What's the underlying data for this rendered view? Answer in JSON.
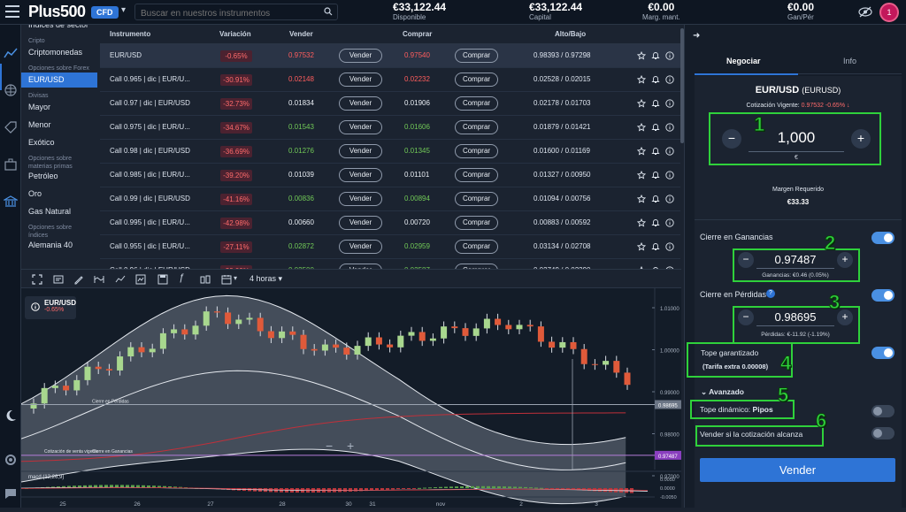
{
  "app": {
    "logo": "Plus500",
    "badge": "CFD"
  },
  "search": {
    "placeholder": "Buscar en nuestros instrumentos"
  },
  "account": [
    {
      "value": "€33,122.44",
      "label": "Disponible"
    },
    {
      "value": "€33,122.44",
      "label": "Capital"
    },
    {
      "value": "€0.00",
      "label": "Marg. mant."
    },
    {
      "value": "€0.00",
      "label": "Gan/Pér"
    }
  ],
  "notifications": {
    "count": "1"
  },
  "categories": [
    {
      "type": "item",
      "label": "Índices de sector"
    },
    {
      "type": "section",
      "label": "Cripto"
    },
    {
      "type": "item",
      "label": "Criptomonedas"
    },
    {
      "type": "section",
      "label": "Opciones sobre Forex"
    },
    {
      "type": "item",
      "label": "EUR/USD",
      "active": true
    },
    {
      "type": "section",
      "label": "Divisas"
    },
    {
      "type": "item",
      "label": "Mayor"
    },
    {
      "type": "item",
      "label": "Menor"
    },
    {
      "type": "item",
      "label": "Exótico"
    },
    {
      "type": "section",
      "label": "Opciones sobre materias primas"
    },
    {
      "type": "item",
      "label": "Petróleo"
    },
    {
      "type": "item",
      "label": "Oro"
    },
    {
      "type": "item",
      "label": "Gas Natural"
    },
    {
      "type": "section",
      "label": "Opciones sobre índices"
    },
    {
      "type": "item",
      "label": "Alemania 40"
    }
  ],
  "table": {
    "headers": {
      "instrument": "Instrumento",
      "change": "Variación",
      "sell": "Vender",
      "buy": "Comprar",
      "highlow": "Alto/Bajo"
    },
    "sell_button": "Vender",
    "buy_button": "Comprar",
    "rows": [
      {
        "name": "EUR/USD",
        "change": "-0.65%",
        "sell": "0.97532",
        "sell_dir": "dn",
        "buy": "0.97540",
        "buy_dir": "dn",
        "highlow": "0.98393 / 0.97298"
      },
      {
        "name": "Call 0.965 | dic | EUR/U...",
        "change": "-30.91%",
        "sell": "0.02148",
        "sell_dir": "dn",
        "buy": "0.02232",
        "buy_dir": "dn",
        "highlow": "0.02528 / 0.02015"
      },
      {
        "name": "Call 0.97 | dic | EUR/USD",
        "change": "-32.73%",
        "sell": "0.01834",
        "sell_dir": "",
        "buy": "0.01906",
        "buy_dir": "",
        "highlow": "0.02178 / 0.01703"
      },
      {
        "name": "Call 0.975 | dic | EUR/U...",
        "change": "-34.67%",
        "sell": "0.01543",
        "sell_dir": "up",
        "buy": "0.01606",
        "buy_dir": "up",
        "highlow": "0.01879 / 0.01421"
      },
      {
        "name": "Call 0.98 | dic | EUR/USD",
        "change": "-36.69%",
        "sell": "0.01276",
        "sell_dir": "up",
        "buy": "0.01345",
        "buy_dir": "up",
        "highlow": "0.01600 / 0.01169"
      },
      {
        "name": "Call 0.985 | dic | EUR/U...",
        "change": "-39.20%",
        "sell": "0.01039",
        "sell_dir": "",
        "buy": "0.01101",
        "buy_dir": "",
        "highlow": "0.01327 / 0.00950"
      },
      {
        "name": "Call 0.99 | dic | EUR/USD",
        "change": "-41.16%",
        "sell": "0.00836",
        "sell_dir": "up",
        "buy": "0.00894",
        "buy_dir": "up",
        "highlow": "0.01094 / 0.00756"
      },
      {
        "name": "Call 0.995 | dic | EUR/U...",
        "change": "-42.98%",
        "sell": "0.00660",
        "sell_dir": "",
        "buy": "0.00720",
        "buy_dir": "",
        "highlow": "0.00883 / 0.00592"
      },
      {
        "name": "Call 0.955 | dic | EUR/U...",
        "change": "-27.11%",
        "sell": "0.02872",
        "sell_dir": "up",
        "buy": "0.02959",
        "buy_dir": "up",
        "highlow": "0.03134 / 0.02708"
      },
      {
        "name": "Call 0.96 | dic | EUR/USD",
        "change": "-29.09%",
        "sell": "0.02500",
        "sell_dir": "up",
        "buy": "0.02587",
        "buy_dir": "up",
        "highlow": "0.02749 / 0.02390"
      }
    ]
  },
  "chart_toolbar": {
    "timeframe": "4 horas"
  },
  "chart": {
    "symbol": "EUR/USD",
    "change": "-0.65%",
    "price_ticks": [
      "1.01000",
      "1.00000",
      "0.99000",
      "0.98000",
      "0.97000"
    ],
    "current_price": "0.97487",
    "level_price": "0.98695",
    "x_ticks": [
      "25",
      "26",
      "27",
      "28",
      "30",
      "31",
      "nov",
      "2",
      "3"
    ],
    "stop_label": "Cierre en Pérdidas",
    "take_label": "Cierre en Ganancias",
    "sell_quote_label": "Cotización de venta vigente",
    "macd_label": "macd (12,26,9)",
    "macd_ticks": [
      "0.0050",
      "0.0000",
      "-0.0050"
    ]
  },
  "panel": {
    "tab_trade": "Negociar",
    "tab_info": "Info",
    "pair": "EUR/USD",
    "pair_sub": "(EURUSD)",
    "quote_label": "Cotización Vigente:",
    "quote_value": "0.97532",
    "quote_change": "-0.65%",
    "amount": "1,000",
    "amount_unit": "€",
    "margin_label": "Margen Requerido",
    "margin_value": "€33.33",
    "take_profit_label": "Cierre en Ganancias",
    "take_profit_value": "0.97487",
    "take_profit_sub": "Ganancias: €0.46  (0.05%)",
    "stop_loss_label": "Cierre en Pérdidas",
    "stop_loss_value": "0.98695",
    "stop_loss_sub": "Pérdidas: €-11.92  (-1.19%)",
    "guaranteed_label": "Tope garantizado",
    "guaranteed_sub": "(Tarifa extra 0.00008)",
    "advanced_label": "Avanzado",
    "trailing_label": "Tope dinámico:",
    "trailing_value": "Pipos",
    "sell_if_label": "Vender si la cotización alcanza",
    "submit": "Vender"
  },
  "annotations": [
    "1",
    "2",
    "3",
    "4",
    "5",
    "6"
  ],
  "colors": {
    "accent": "#2e74d6",
    "down": "#ff5d5d",
    "up": "#71c957",
    "annotation": "#2fd13b"
  }
}
